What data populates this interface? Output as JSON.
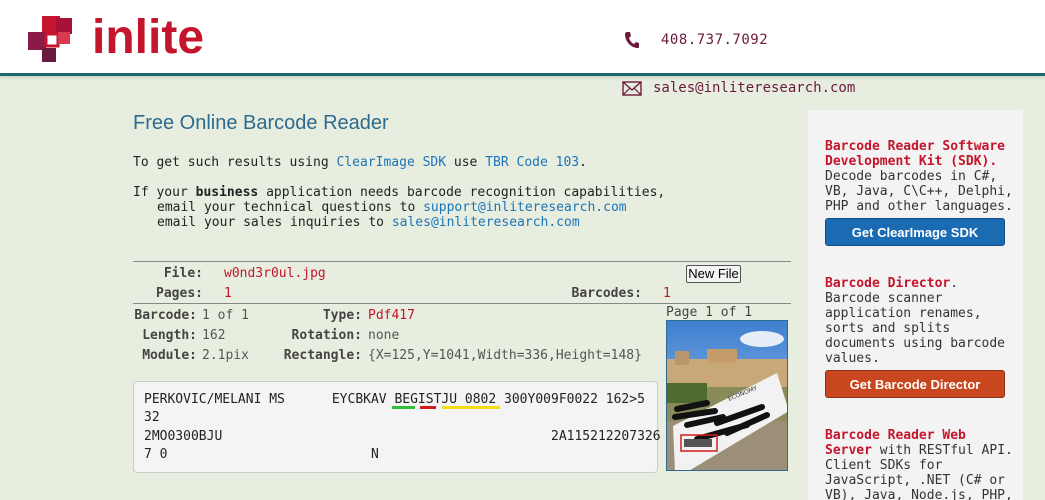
{
  "header": {
    "logo_text": "inlite",
    "phone": "408.737.7092",
    "email": "sales@inliteresearch.com",
    "brand_color": "#c4152c",
    "accent_color": "#1d6b6e"
  },
  "main": {
    "title": "Free Online Barcode Reader",
    "intro1": {
      "pre": "To get such results using ",
      "sdk_link": "ClearImage SDK",
      "mid": " use ",
      "code_link": "TBR Code 103",
      "post": "."
    },
    "intro2": {
      "pre": "If your ",
      "bold": "business",
      "post": " application needs barcode recognition capabilities,"
    },
    "intro3": {
      "pre": "email your technical questions to ",
      "link": "support@inliteresearch.com"
    },
    "intro4": {
      "pre": "email your sales inquiries to ",
      "link": "sales@inliteresearch.com"
    }
  },
  "file_info": {
    "file_label": "File:",
    "file_value": "w0nd3r0ul.jpg",
    "pages_label": "Pages:",
    "pages_value": "1",
    "barcodes_label": "Barcodes:",
    "barcodes_value": "1",
    "new_file_button": "New File"
  },
  "barcode": {
    "barcode_label": "Barcode:",
    "barcode_value": "1 of 1",
    "type_label": "Type:",
    "type_value": "Pdf417",
    "length_label": "Length:",
    "length_value": "162",
    "rotation_label": "Rotation:",
    "rotation_value": "none",
    "module_label": "Module:",
    "module_value": "2.1pix",
    "rectangle_label": "Rectangle:",
    "rectangle_value": "{X=125,Y=1041,Width=336,Height=148}"
  },
  "decoded_text": {
    "line1": "PERKOVIC/MELANI MS      EYCBKAV BEGISTJU 0802 300Y009F0022 162>5",
    "line2": "32",
    "line3": "2MO0300BJU                                          2A115212207326",
    "line4": "7 0                          N"
  },
  "thumbnail": {
    "caption": "Page 1 of 1",
    "icon": "boarding-pass-photo"
  },
  "sidebar": {
    "sdk_head": "Barcode Reader Software Development Kit (SDK).",
    "sdk_body": "Decode barcodes in C#, VB, Java, C\\C++, Delphi, PHP and other languages.",
    "sdk_button": "Get ClearImage SDK",
    "director_head": "Barcode Director",
    "director_body": "Barcode scanner application renames, sorts and splits documents using barcode values.",
    "director_button": "Get Barcode Director",
    "web_head": "Barcode Reader Web Server",
    "web_body": " with RESTful API. Client SDKs for JavaScript, .NET (C# or VB), Java, Node.js, PHP,"
  }
}
